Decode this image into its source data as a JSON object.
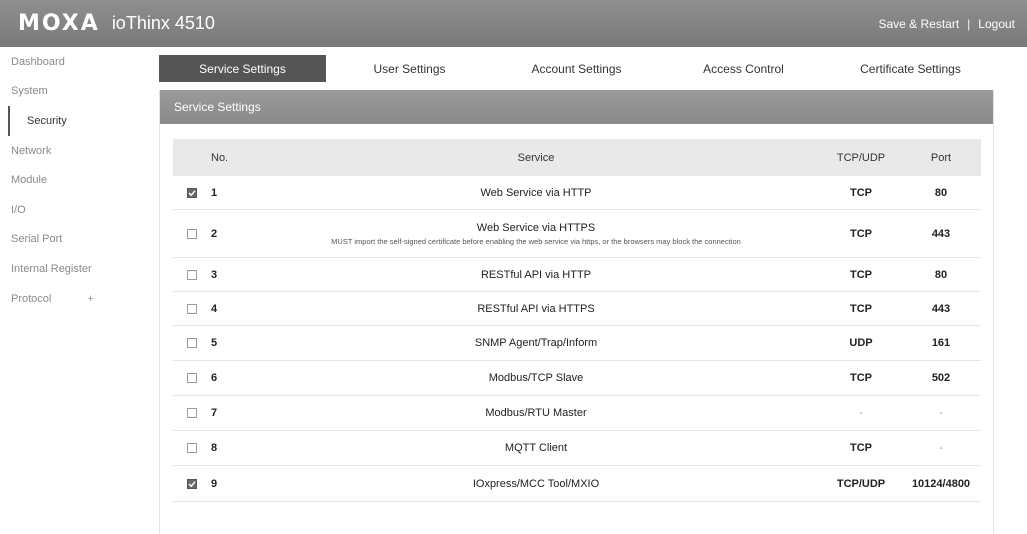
{
  "header": {
    "logo": "MOXA",
    "product": "ioThinx 4510",
    "save_restart": "Save & Restart",
    "separator": "|",
    "logout": "Logout"
  },
  "sidebar": {
    "items": [
      {
        "label": "Dashboard"
      },
      {
        "label": "System"
      },
      {
        "label": "Security"
      },
      {
        "label": "Network"
      },
      {
        "label": "Module"
      },
      {
        "label": "I/O"
      },
      {
        "label": "Serial Port"
      },
      {
        "label": "Internal Register"
      },
      {
        "label": "Protocol",
        "expand": "+"
      }
    ]
  },
  "tabs": [
    {
      "label": "Service Settings"
    },
    {
      "label": "User Settings"
    },
    {
      "label": "Account Settings"
    },
    {
      "label": "Access Control"
    },
    {
      "label": "Certificate Settings"
    }
  ],
  "panel": {
    "title": "Service Settings"
  },
  "table": {
    "headers": {
      "no": "No.",
      "service": "Service",
      "protocol": "TCP/UDP",
      "port": "Port"
    },
    "rows": [
      {
        "no": "1",
        "service": "Web Service via HTTP",
        "note": "",
        "protocol": "TCP",
        "port": "80",
        "checked": true
      },
      {
        "no": "2",
        "service": "Web Service via HTTPS",
        "note": "MUST import the self-signed certificate before enabling the web service via https, or the browsers may block the connection",
        "protocol": "TCP",
        "port": "443",
        "checked": false
      },
      {
        "no": "3",
        "service": "RESTful API via HTTP",
        "note": "",
        "protocol": "TCP",
        "port": "80",
        "checked": false
      },
      {
        "no": "4",
        "service": "RESTful API via HTTPS",
        "note": "",
        "protocol": "TCP",
        "port": "443",
        "checked": false
      },
      {
        "no": "5",
        "service": "SNMP Agent/Trap/Inform",
        "note": "",
        "protocol": "UDP",
        "port": "161",
        "checked": false
      },
      {
        "no": "6",
        "service": "Modbus/TCP Slave",
        "note": "",
        "protocol": "TCP",
        "port": "502",
        "checked": false
      },
      {
        "no": "7",
        "service": "Modbus/RTU Master",
        "note": "",
        "protocol": "-",
        "port": "-",
        "checked": false
      },
      {
        "no": "8",
        "service": "MQTT Client",
        "note": "",
        "protocol": "TCP",
        "port": "-",
        "checked": false
      },
      {
        "no": "9",
        "service": "IOxpress/MCC Tool/MXIO",
        "note": "",
        "protocol": "TCP/UDP",
        "port": "10124/4800",
        "checked": true
      }
    ]
  },
  "colors": {
    "header_bg": "#808080",
    "active_tab": "#555555",
    "table_header_bg": "#e9e9e9"
  }
}
